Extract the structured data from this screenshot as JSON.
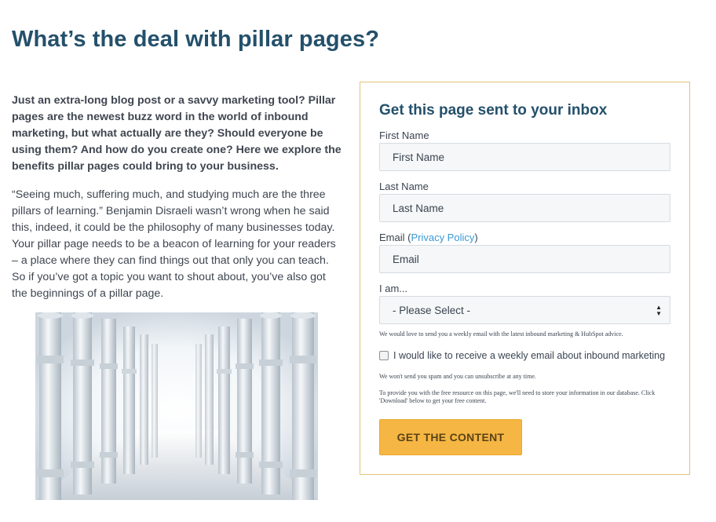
{
  "page": {
    "title": "What’s the deal with pillar pages?"
  },
  "article": {
    "intro": "Just an extra-long blog post or a savvy marketing tool? Pillar pages are the newest buzz word in the world of inbound marketing, but what actually are they? Should everyone be using them? And how do you create one? Here we explore the benefits pillar pages could bring to your business.",
    "quote": "“Seeing much, suffering much, and studying much are the three pillars of learning.” Benjamin Disraeli wasn’t wrong when he said this, indeed, it could be the philosophy of many businesses today. Your pillar page needs to be a beacon of learning for your readers – a place where they can find things out that only you can teach. So if you’ve got a topic you want to shout about, you’ve also got the beginnings of a pillar page."
  },
  "form": {
    "title": "Get this page sent to your inbox",
    "first_name": {
      "label": "First Name",
      "placeholder": "First Name",
      "value": ""
    },
    "last_name": {
      "label": "Last Name",
      "placeholder": "Last Name",
      "value": ""
    },
    "email": {
      "label": "Email (",
      "link": "Privacy Policy",
      "label_end": ")",
      "placeholder": "Email",
      "value": ""
    },
    "role": {
      "label": "I am...",
      "selected": "- Please Select -"
    },
    "weekly_note": "We would love to send you a weekly email with the latest inbound marketing & HubSpot advice.",
    "checkbox_label": "I would like to receive a weekly email about inbound marketing",
    "checkbox_checked": false,
    "spam_note": "We won't send you spam and you can unsubscribe at any time.",
    "storage_note": "To provide you with the free resource on this page, we'll need to store your information in our database. Click 'Download' below to get your free content.",
    "submit_label": "GET THE CONTENT"
  },
  "colors": {
    "heading": "#24506b",
    "link": "#3a9ad6",
    "button": "#f5b643",
    "card_border": "#e4c27a"
  }
}
